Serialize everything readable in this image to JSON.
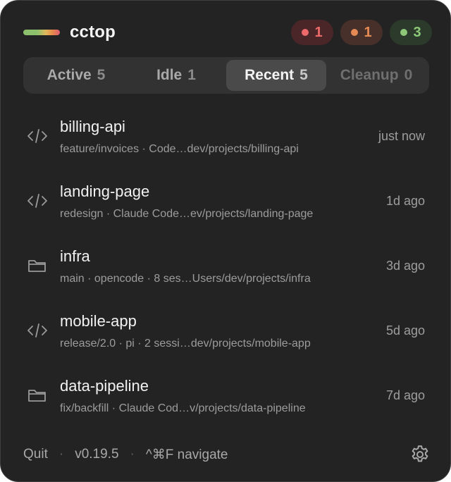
{
  "app": {
    "title": "cctop"
  },
  "badges": [
    {
      "count": "1",
      "color": "#ee6a6a"
    },
    {
      "count": "1",
      "color": "#e58a55"
    },
    {
      "count": "3",
      "color": "#8cc877"
    }
  ],
  "tabs": [
    {
      "label": "Active",
      "count": "5"
    },
    {
      "label": "Idle",
      "count": "1"
    },
    {
      "label": "Recent",
      "count": "5",
      "selected": true
    },
    {
      "label": "Cleanup",
      "count": "0"
    }
  ],
  "sessions": [
    {
      "name": "billing-api",
      "detail": "feature/invoices · Code…dev/projects/billing-api",
      "time": "just now",
      "icon": "code-icon"
    },
    {
      "name": "landing-page",
      "detail": "redesign · Claude Code…ev/projects/landing-page",
      "time": "1d ago",
      "icon": "code-icon"
    },
    {
      "name": "infra",
      "detail": "main · opencode · 8 ses…Users/dev/projects/infra",
      "time": "3d ago",
      "icon": "folder-icon"
    },
    {
      "name": "mobile-app",
      "detail": "release/2.0 · pi · 2 sessi…dev/projects/mobile-app",
      "time": "5d ago",
      "icon": "code-icon"
    },
    {
      "name": "data-pipeline",
      "detail": "fix/backfill · Claude Cod…v/projects/data-pipeline",
      "time": "7d ago",
      "icon": "folder-icon"
    }
  ],
  "footer": {
    "quit_label": "Quit",
    "separator": "·",
    "version": "v0.19.5",
    "shortcut": "^⌘F navigate",
    "settings_icon": "gear-icon"
  }
}
